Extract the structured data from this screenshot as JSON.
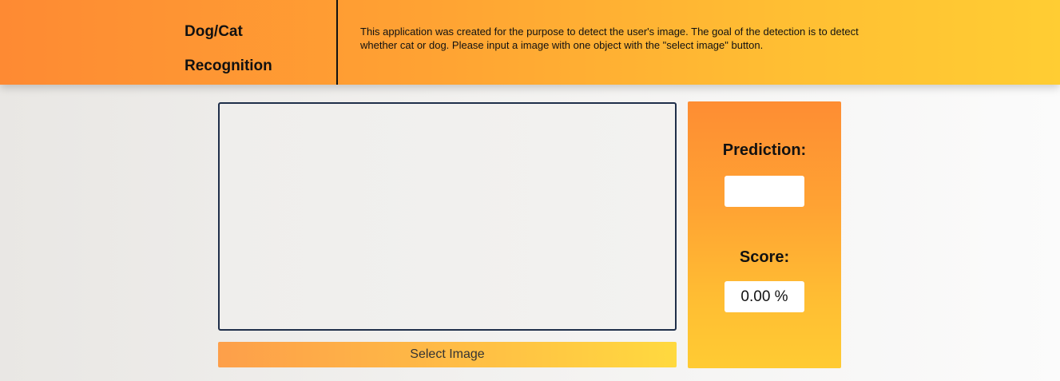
{
  "header": {
    "title_line1": "Dog/Cat",
    "title_line2": "Recognition",
    "description": "This application was created for the purpose to detect the user's image. The goal of the detection is to detect whether cat or dog. Please input a image with one object with the \"select image\" button."
  },
  "main": {
    "select_button_label": "Select Image"
  },
  "results": {
    "prediction_label": "Prediction:",
    "prediction_value": "",
    "score_label": "Score:",
    "score_value": "0.00 %"
  },
  "colors": {
    "header_gradient_start": "#fe8a33",
    "header_gradient_end": "#ffcd33",
    "frame_border": "#1f2f4a",
    "button_gradient_start": "#fd9f4a",
    "button_gradient_end": "#ffd93f"
  }
}
